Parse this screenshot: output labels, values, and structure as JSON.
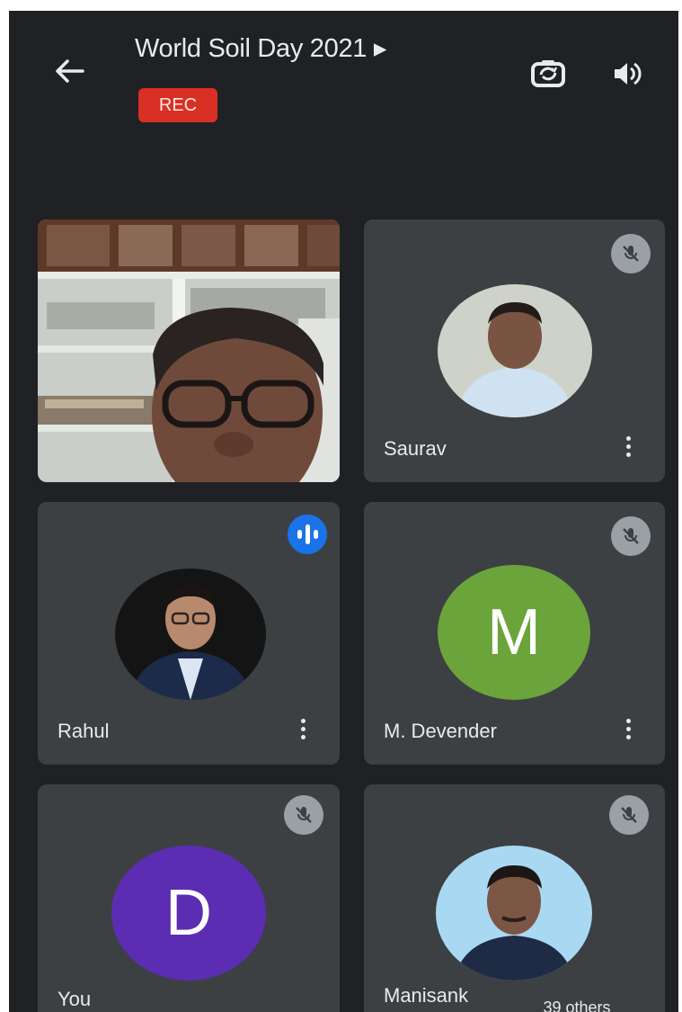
{
  "header": {
    "title": "World Soil Day 2021 ▸",
    "rec_label": "REC"
  },
  "icons": {
    "back": "arrow-back-icon",
    "switch_camera": "switch-camera-icon",
    "speaker": "speaker-volume-icon",
    "muted": "mic-off-icon",
    "speaking": "speaking-indicator-icon",
    "more": "more-vert-icon"
  },
  "participants": [
    {
      "name": "",
      "type": "video",
      "muted": false
    },
    {
      "name": "Saurav",
      "type": "photo",
      "muted": true
    },
    {
      "name": "Rahul",
      "type": "photo",
      "speaking": true
    },
    {
      "name": "M. Devender",
      "type": "letter",
      "letter": "M",
      "avatar_color": "#6aa43a",
      "muted": true
    },
    {
      "name": "You",
      "type": "letter",
      "letter": "D",
      "avatar_color": "#5c2db3",
      "muted": true
    },
    {
      "name": "Manisank",
      "type": "photo",
      "muted": true
    }
  ],
  "others_chip": "39 others",
  "colors": {
    "background": "#202124",
    "tile": "#3c4043",
    "rec": "#d93025",
    "speaking": "#1a73e8"
  }
}
